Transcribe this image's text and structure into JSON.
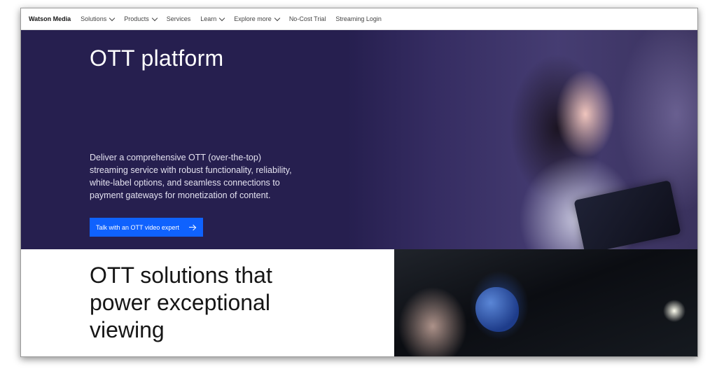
{
  "nav": {
    "brand": "Watson Media",
    "items": [
      {
        "label": "Solutions",
        "dropdown": true
      },
      {
        "label": "Products",
        "dropdown": true
      },
      {
        "label": "Services",
        "dropdown": false
      },
      {
        "label": "Learn",
        "dropdown": true
      },
      {
        "label": "Explore more",
        "dropdown": true
      },
      {
        "label": "No-Cost Trial",
        "dropdown": false
      },
      {
        "label": "Streaming Login",
        "dropdown": false
      }
    ]
  },
  "hero": {
    "title": "OTT platform",
    "description": "Deliver a comprehensive OTT (over-the-top) streaming service with robust functionality, reliability, white-label options, and seamless connections to payment gateways for monetization of content.",
    "cta_label": "Talk with an OTT video expert",
    "cta_color": "#0f62fe",
    "background_color": "#261f4f"
  },
  "section": {
    "title": "OTT solutions that power exceptional viewing"
  },
  "icons": {
    "dropdown": "chevron-down-icon",
    "cta": "arrow-right-icon"
  }
}
